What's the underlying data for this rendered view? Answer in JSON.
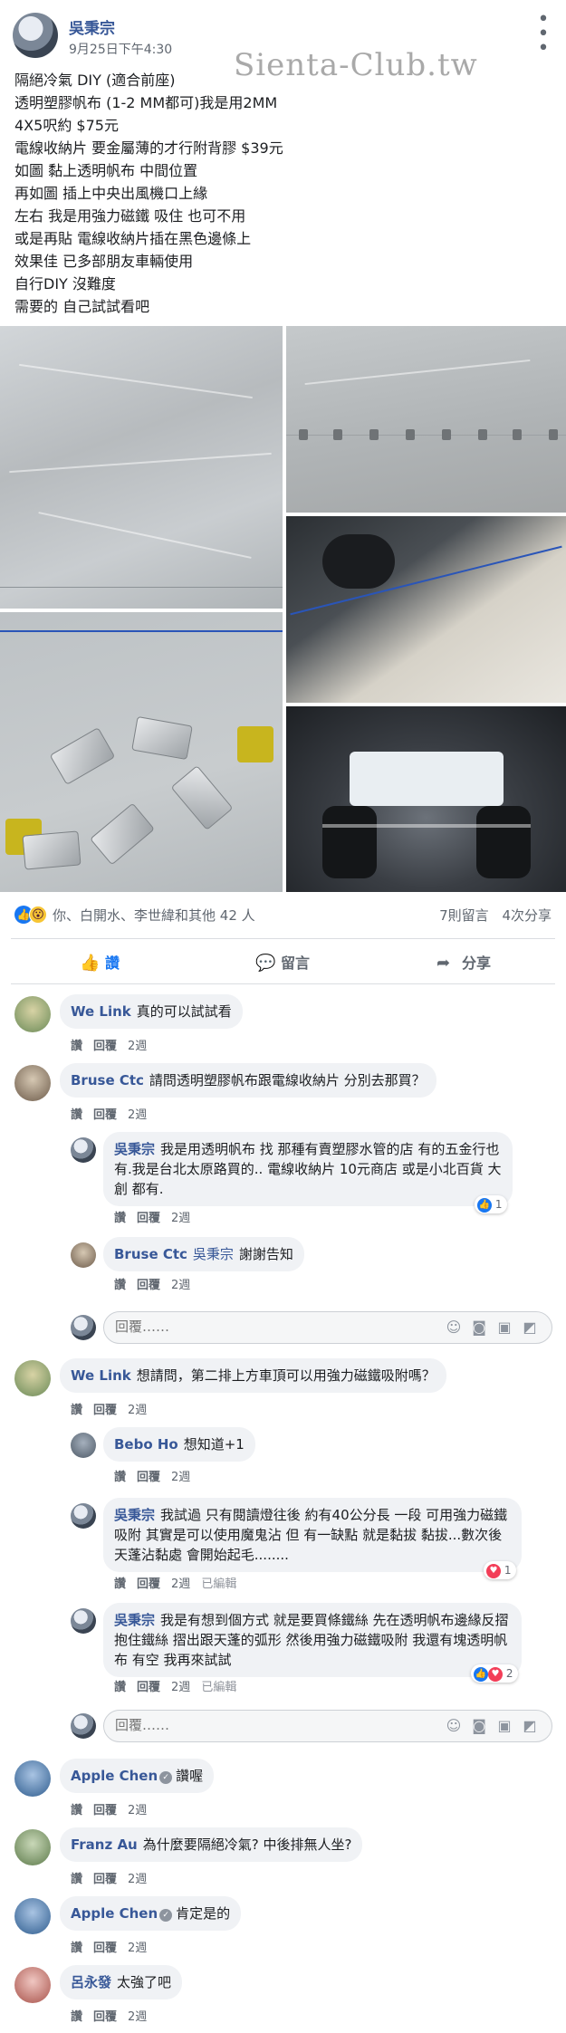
{
  "post": {
    "author": "吳秉宗",
    "timestamp": "9月25日下午4:30",
    "watermark": "Sienta-Club.tw",
    "lines": [
      "隔絕冷氣 DIY (適合前座)",
      "透明塑膠帆布 (1-2 MM都可)我是用2MM",
      "4X5呎約 $75元",
      "電線收納片 要金屬薄的才行附背膠 $39元",
      "如圖 黏上透明帆布 中間位置",
      "再如圖 插上中央出風機口上緣",
      "左右 我是用強力磁鐵 吸住 也可不用",
      "或是再貼 電線收納片插在黑色邊條上",
      "效果佳 已多部朋友車輛使用",
      "自行DIY 沒難度",
      "需要的 自己試試看吧"
    ]
  },
  "reactions": {
    "summary": "你、白開水、李世緯和其他 42 人",
    "comments_count": "7則留言",
    "shares_count": "4次分享"
  },
  "actions": {
    "like": "讚",
    "comment": "留言",
    "share": "分享"
  },
  "meta_labels": {
    "like": "讚",
    "reply": "回覆",
    "edited": "已編輯",
    "reply_placeholder": "回覆……"
  },
  "comments": [
    {
      "name": "We Link",
      "text": "真的可以試試看",
      "age": "2週"
    },
    {
      "name": "Bruse Ctc",
      "text": "請問透明塑膠帆布跟電線收納片 分別去那買？",
      "age": "2週"
    },
    {
      "name": "吳秉宗",
      "text": "我試過 只有閱讀燈往後 約有40公分長 一段 可用強力磁鐵吸附 其實是可以使用魔鬼沾 但 有一缺點 就是黏拔 黏拔...數次後 天蓬沾黏處 會開始起毛........",
      "age": "2週"
    },
    {
      "name": "We Link",
      "text": "想請問，第二排上方車頂可以用強力磁鐵吸附嗎？",
      "age": "2週"
    },
    {
      "name": "Apple Chen",
      "text": "讚喔",
      "age": "2週"
    },
    {
      "name": "Franz Au",
      "text": "為什麼要隔絕冷氣? 中後排無人坐?",
      "age": "2週"
    },
    {
      "name": "Apple Chen",
      "text": "肯定是的",
      "age": "2週"
    },
    {
      "name": "呂永發",
      "text": "太強了吧",
      "age": "2週"
    }
  ],
  "replies": {
    "r1": {
      "name": "吳秉宗",
      "text": "我是用透明帆布 找 那種有賣塑膠水管的店 有的五金行也有.我是台北太原路買的.. 電線收納片 10元商店 或是小北百貨 大創 都有.",
      "age": "2週",
      "reaction_count": "1"
    },
    "r2": {
      "name": "Bruse Ctc",
      "tag": "吳秉宗",
      "text": "謝謝告知",
      "age": "2週"
    },
    "r3": {
      "name": "Bebo Ho",
      "text": "想知道+1",
      "age": "2週"
    },
    "r4": {
      "name": "吳秉宗",
      "text": "我試過 只有閱讀燈往後 約有40公分長 一段 可用強力磁鐵吸附 其實是可以使用魔鬼沾 但 有一缺點 就是黏拔 黏拔...數次後 天蓬沾黏處 會開始起毛........",
      "age": "2週",
      "reaction_count": "1"
    },
    "r5": {
      "name": "吳秉宗",
      "text": "我是有想到個方式 就是要買條鐵絲 先在透明帆布邊緣反摺抱住鐵絲 摺出跟天蓬的弧形 然後用強力磁鐵吸附 我還有塊透明帆布 有空 我再來試試",
      "age": "2週",
      "reaction_count": "2"
    }
  }
}
